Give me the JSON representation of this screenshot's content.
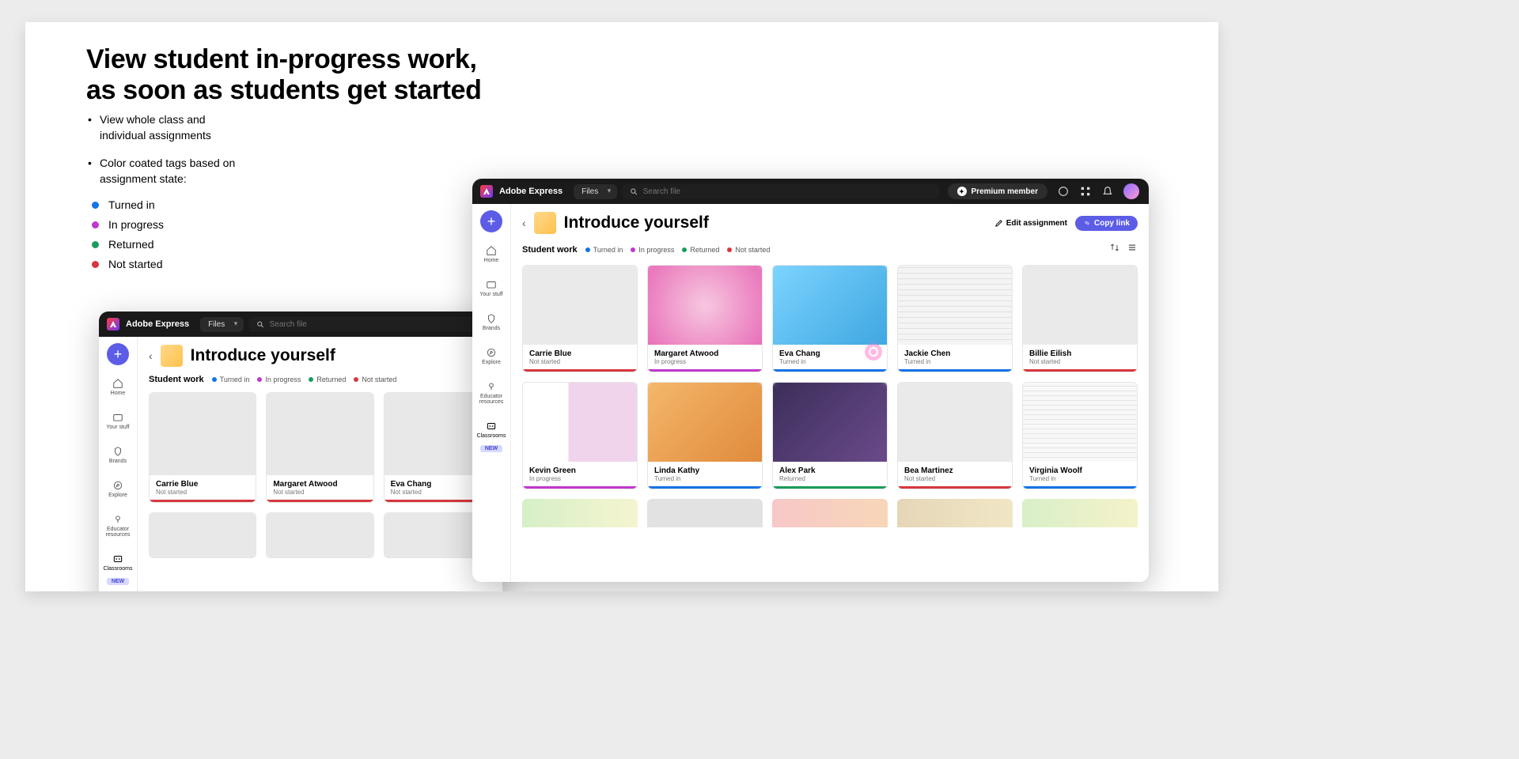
{
  "feature": {
    "heading_l1": "View student in-progress work,",
    "heading_l2": "as soon as students get started",
    "bullets": [
      "View whole class and individual assignments",
      "Color coated tags based on assignment state:"
    ],
    "legend": [
      {
        "label": "Turned in",
        "color": "blue"
      },
      {
        "label": "In progress",
        "color": "pink"
      },
      {
        "label": "Returned",
        "color": "green"
      },
      {
        "label": "Not started",
        "color": "red"
      }
    ]
  },
  "app": {
    "brand": "Adobe Express",
    "files_dropdown": "Files",
    "search_placeholder": "Search file",
    "premium_label": "Premium member",
    "nav": {
      "home": "Home",
      "your_stuff": "Your stuff",
      "brands": "Brands",
      "explore": "Explore",
      "educator": "Educator resources",
      "classrooms": "Classrooms",
      "new_badge": "NEW"
    },
    "assignment_title": "Introduce yourself",
    "edit_assignment": "Edit assignment",
    "copy_link": "Copy link",
    "student_work_label": "Student work",
    "statuses": {
      "turned_in": "Turned in",
      "in_progress": "In progress",
      "returned": "Returned",
      "not_started": "Not started"
    }
  },
  "small_cards": [
    {
      "name": "Carrie Blue",
      "status": "Not started",
      "c": "red"
    },
    {
      "name": "Margaret Atwood",
      "status": "Not started",
      "c": "red"
    },
    {
      "name": "Eva Chang",
      "status": "Not started",
      "c": "red"
    }
  ],
  "large_cards": [
    {
      "name": "Carrie Blue",
      "status": "Not started",
      "c": "red",
      "thumb": "plain"
    },
    {
      "name": "Margaret Atwood",
      "status": "In progress",
      "c": "pink",
      "thumb": "pinkish"
    },
    {
      "name": "Eva Chang",
      "status": "Turned in",
      "c": "blue",
      "thumb": "cyan"
    },
    {
      "name": "Jackie Chen",
      "status": "Turned in",
      "c": "blue",
      "thumb": "paper"
    },
    {
      "name": "Billie Eilish",
      "status": "Not started",
      "c": "red",
      "thumb": "plain"
    },
    {
      "name": "Kevin Green",
      "status": "In progress",
      "c": "pink",
      "thumb": "intro"
    },
    {
      "name": "Linda Kathy",
      "status": "Turned in",
      "c": "blue",
      "thumb": "orange"
    },
    {
      "name": "Alex Park",
      "status": "Returned",
      "c": "green",
      "thumb": "dark"
    },
    {
      "name": "Bea Martinez",
      "status": "Not started",
      "c": "red",
      "thumb": "plain"
    },
    {
      "name": "Virginia Woolf",
      "status": "Turned in",
      "c": "blue",
      "thumb": "paper2"
    }
  ]
}
